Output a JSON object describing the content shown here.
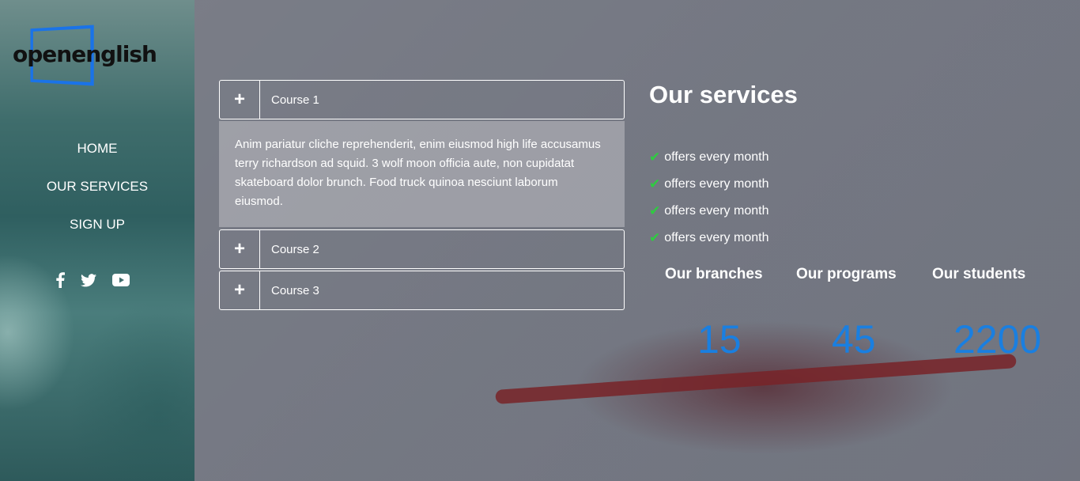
{
  "brand": {
    "logo_text": "openenglish"
  },
  "nav": {
    "items": [
      {
        "label": "HOME"
      },
      {
        "label": "OUR SERVICES"
      },
      {
        "label": "SIGN UP"
      }
    ]
  },
  "social": [
    {
      "icon": "facebook-icon"
    },
    {
      "icon": "twitter-icon"
    },
    {
      "icon": "youtube-icon"
    }
  ],
  "accordion": {
    "items": [
      {
        "title": "Course 1",
        "expanded": true,
        "body": "Anim pariatur cliche reprehenderit, enim eiusmod high life accusamus terry richardson ad squid. 3 wolf moon officia aute, non cupidatat skateboard dolor brunch. Food truck quinoa nesciunt laborum eiusmod."
      },
      {
        "title": "Course 2",
        "expanded": false
      },
      {
        "title": "Course 3",
        "expanded": false
      }
    ],
    "toggle_symbol": "+"
  },
  "services": {
    "title": "Our services",
    "items": [
      {
        "text": "offers every month"
      },
      {
        "text": "offers every month"
      },
      {
        "text": "offers every month"
      },
      {
        "text": "offers every month"
      }
    ]
  },
  "stats": [
    {
      "label": "Our branches",
      "value": "15"
    },
    {
      "label": "Our programs",
      "value": "45"
    },
    {
      "label": "Our students",
      "value": "2200"
    }
  ],
  "colors": {
    "accent": "#1a7fe0",
    "check": "#2ecc40"
  }
}
